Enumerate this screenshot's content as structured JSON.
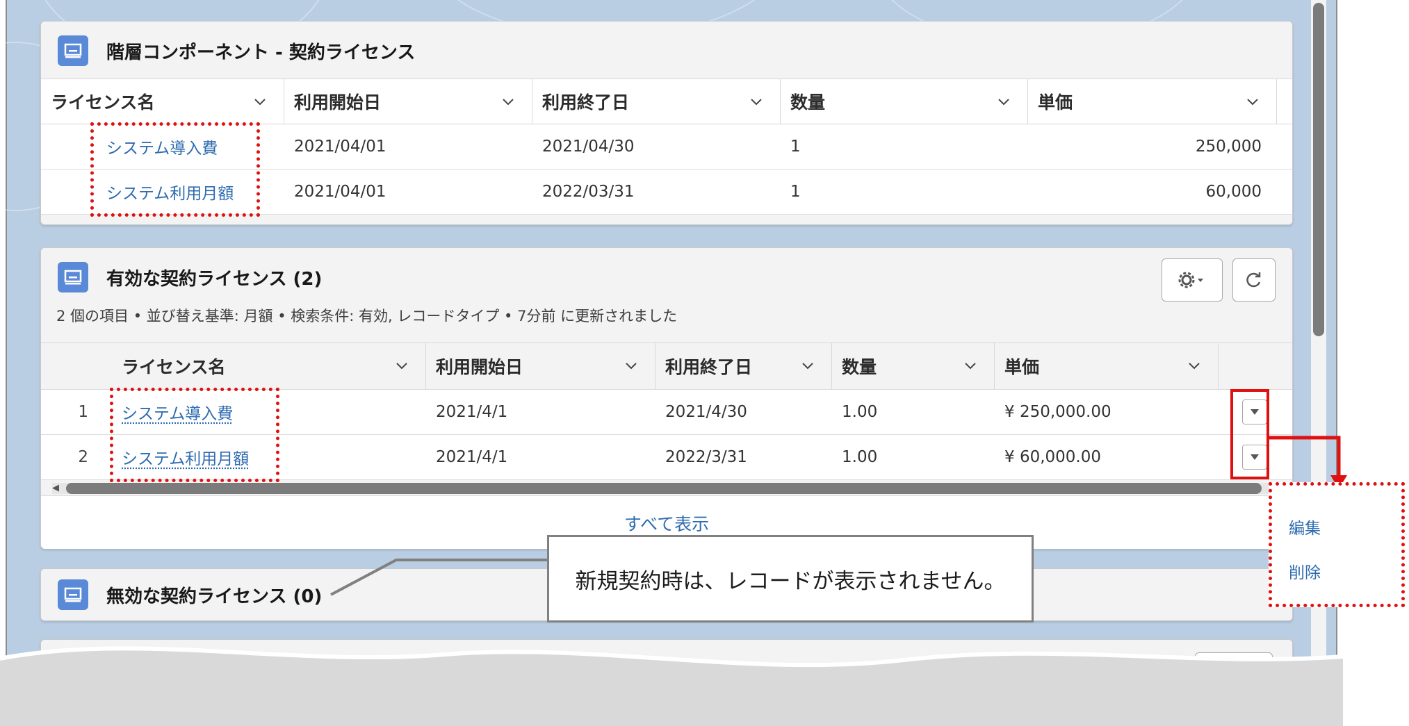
{
  "hier_card": {
    "title": "階層コンポーネント - 契約ライセンス",
    "columns": [
      "ライセンス名",
      "利用開始日",
      "利用終了日",
      "数量",
      "単価"
    ],
    "rows": [
      {
        "name": "システム導入費",
        "start": "2021/04/01",
        "end": "2021/04/30",
        "qty": "1",
        "price": "250,000"
      },
      {
        "name": "システム利用月額",
        "start": "2021/04/01",
        "end": "2022/03/31",
        "qty": "1",
        "price": "60,000"
      }
    ]
  },
  "active_card": {
    "title": "有効な契約ライセンス (2)",
    "subtitle": "2 個の項目 • 並び替え基準: 月額 • 検索条件: 有効, レコードタイプ • 7分前 に更新されました",
    "columns": [
      "ライセンス名",
      "利用開始日",
      "利用終了日",
      "数量",
      "単価"
    ],
    "rows": [
      {
        "num": "1",
        "name": "システム導入費",
        "start": "2021/4/1",
        "end": "2021/4/30",
        "qty": "1.00",
        "price": "¥ 250,000.00"
      },
      {
        "num": "2",
        "name": "システム利用月額",
        "start": "2021/4/1",
        "end": "2022/3/31",
        "qty": "1.00",
        "price": "¥ 60,000.00"
      }
    ],
    "view_all": "すべて表示"
  },
  "inactive_card": {
    "title": "無効な契約ライセンス (0)"
  },
  "callout": {
    "text": "新規契約時は、レコードが表示されません。"
  },
  "row_menu": {
    "items": [
      "編集",
      "削除"
    ]
  },
  "colors": {
    "annotation_red": "#e01010",
    "link_blue": "#2e6bb0",
    "icon_blue": "#5a8ad7"
  }
}
